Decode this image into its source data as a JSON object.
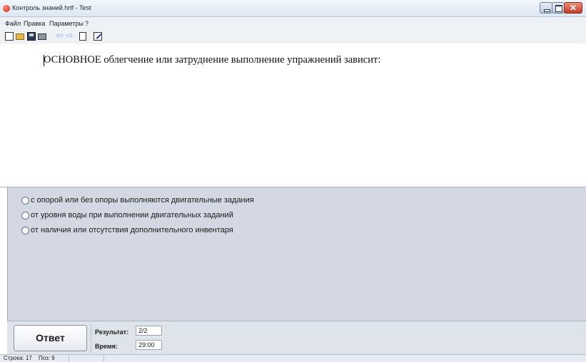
{
  "window": {
    "title": "Контроль знаний.hrtf - Test",
    "close_glyph": "✕"
  },
  "menu": {
    "items": [
      "Файл",
      "Правка",
      "Параметры",
      "?"
    ]
  },
  "toolbar": {
    "icons": [
      "new-document-icon",
      "open-folder-icon",
      "save-disk-icon",
      "print-icon",
      "arrow-left-icon",
      "arrow-right-icon",
      "page-icon",
      "edit-icon"
    ],
    "back_glyph": "⇦",
    "forward_glyph": "⇨"
  },
  "question": {
    "text": "ОСНОВНОЕ облегчение или затруднение выполнение упражнений зависит:"
  },
  "answers": [
    {
      "label": "с опорой или без опоры выполняются двигательные задания",
      "selected": false
    },
    {
      "label": "от уровня воды при выполнении двигательных заданий",
      "selected": false
    },
    {
      "label": "от наличия или отсутствия дополнительного инвентаря",
      "selected": false
    }
  ],
  "bottom": {
    "answer_button": "Ответ",
    "result_label": "Результат:",
    "result_value": "2/2",
    "time_label": "Время:",
    "time_value": "29:00"
  },
  "status": {
    "line": "Строка: 17",
    "pos": "Поз: 9"
  }
}
